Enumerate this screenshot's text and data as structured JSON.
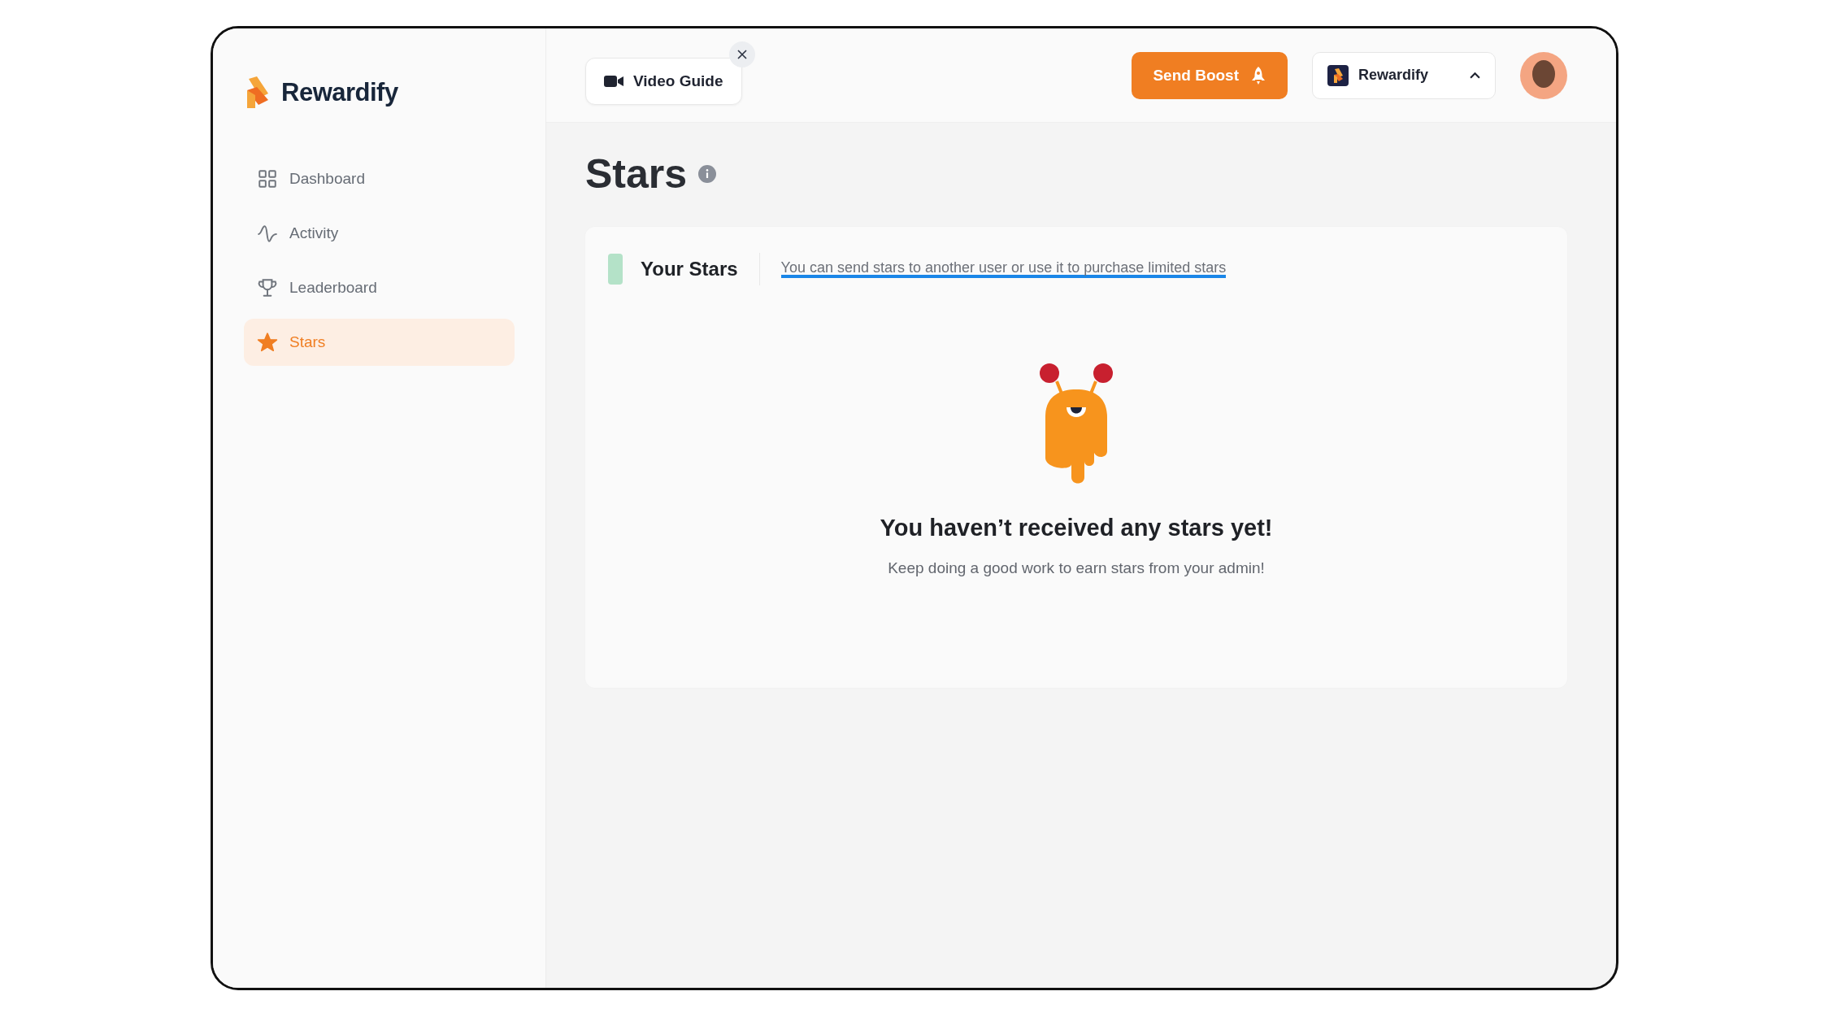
{
  "brand": {
    "name": "Rewardify"
  },
  "sidebar": {
    "items": [
      {
        "label": "Dashboard",
        "selected": false
      },
      {
        "label": "Activity",
        "selected": false
      },
      {
        "label": "Leaderboard",
        "selected": false
      },
      {
        "label": "Stars",
        "selected": true
      }
    ]
  },
  "topbar": {
    "video_guide": "Video Guide",
    "send_boost": "Send Boost",
    "workspace": "Rewardify"
  },
  "page": {
    "title": "Stars"
  },
  "card": {
    "title": "Your Stars",
    "hint": "You can send stars to another user or use it to purchase limited stars",
    "empty_title": "You haven’t received any stars yet!",
    "empty_message": "Keep doing a good work to earn stars from your admin!"
  }
}
